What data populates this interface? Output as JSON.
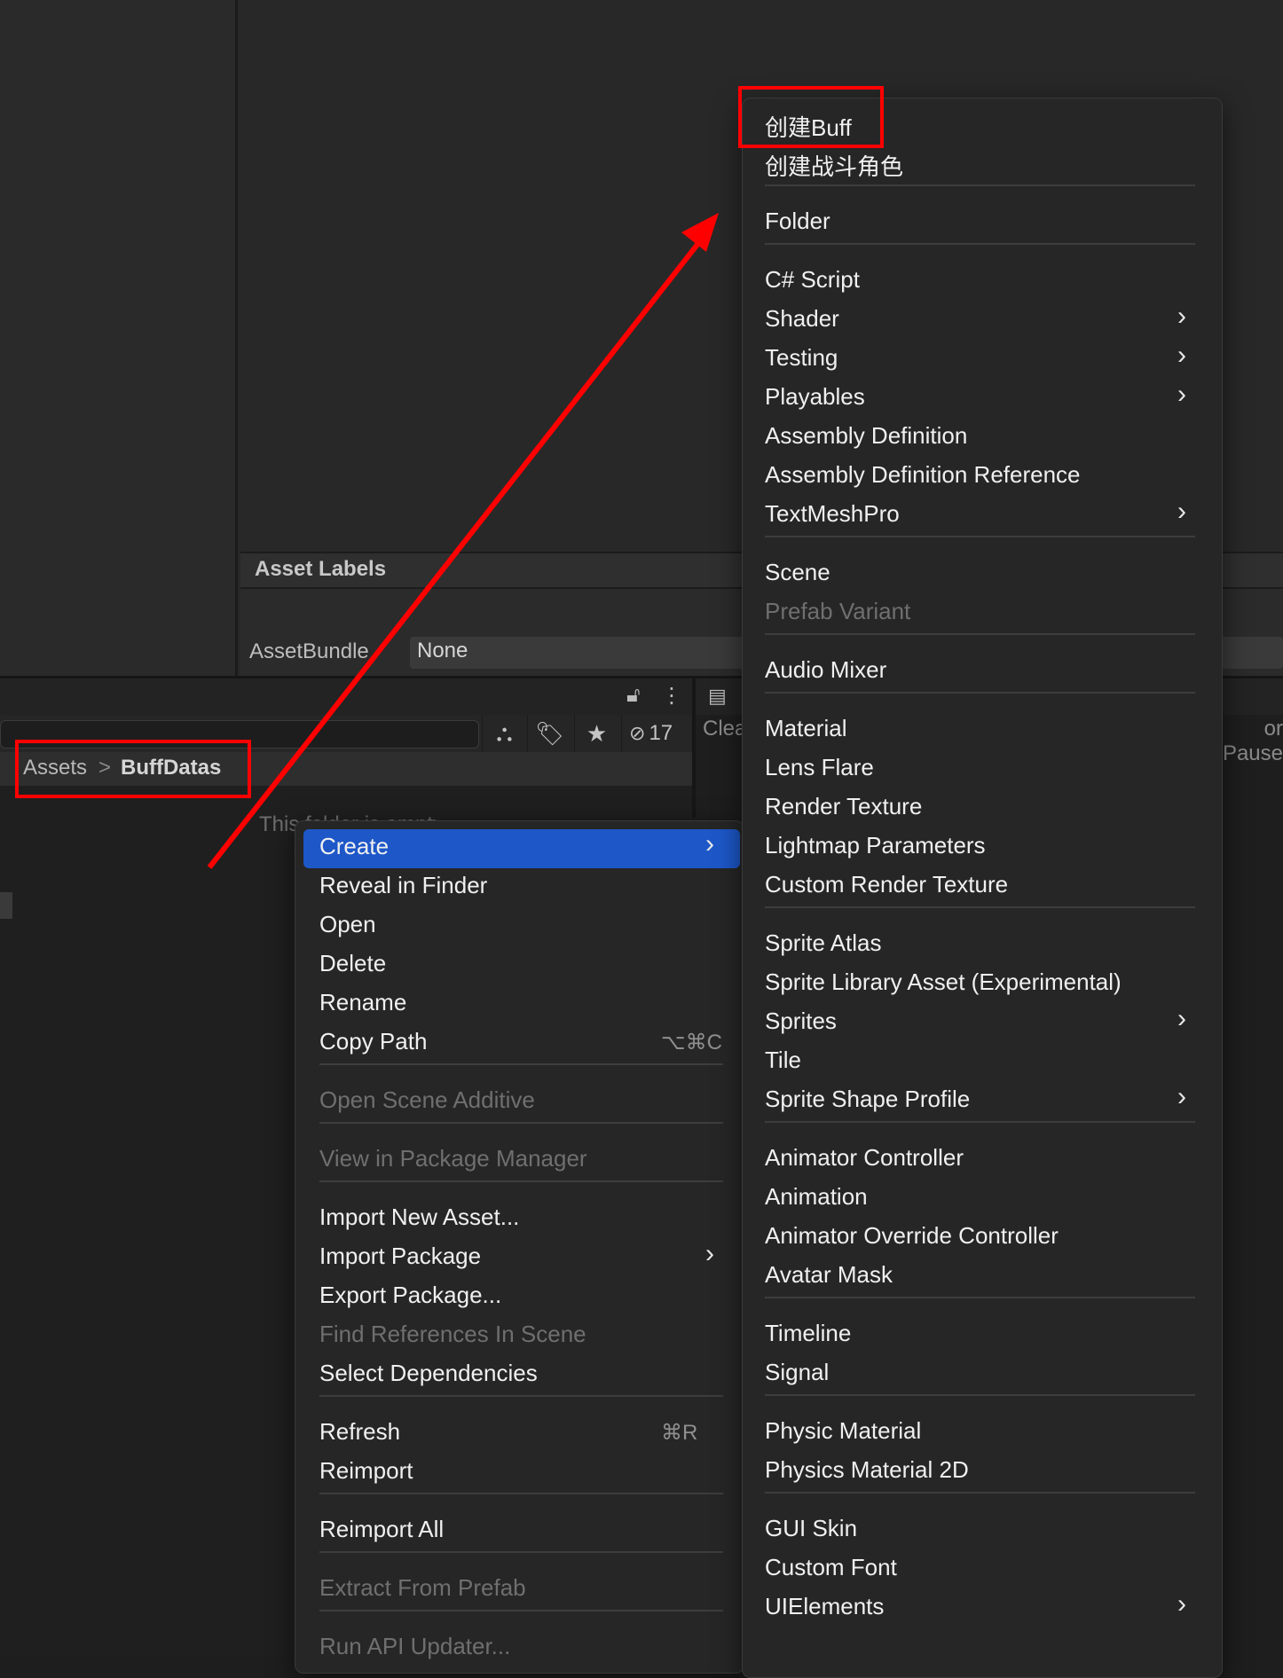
{
  "inspector": {
    "asset_labels_title": "Asset Labels",
    "assetbundle_label": "AssetBundle",
    "assetbundle_value": "None"
  },
  "project": {
    "hidden_count": "17",
    "breadcrumb": {
      "root": "Assets",
      "separator": ">",
      "folder": "BuffDatas"
    },
    "empty_hint": "This folder is empty"
  },
  "console": {
    "clear_label": "Clear",
    "pause_label": "or Pause"
  },
  "context_menu": {
    "items": [
      {
        "label": "Create",
        "submenu": true,
        "highlighted": true
      },
      {
        "label": "Reveal in Finder"
      },
      {
        "label": "Open"
      },
      {
        "label": "Delete"
      },
      {
        "label": "Rename"
      },
      {
        "label": "Copy Path",
        "shortcut": "⌥⌘C"
      },
      {
        "label": "Open Scene Additive",
        "disabled": true
      },
      {
        "label": "View in Package Manager",
        "disabled": true
      },
      {
        "label": "Import New Asset..."
      },
      {
        "label": "Import Package",
        "submenu": true
      },
      {
        "label": "Export Package..."
      },
      {
        "label": "Find References In Scene",
        "disabled": true
      },
      {
        "label": "Select Dependencies"
      },
      {
        "label": "Refresh",
        "shortcut": "⌘R"
      },
      {
        "label": "Reimport"
      },
      {
        "label": "Reimport All"
      },
      {
        "label": "Extract From Prefab",
        "disabled": true
      },
      {
        "label": "Run API Updater...",
        "disabled": true
      }
    ]
  },
  "create_menu": {
    "items": [
      {
        "label": "创建Buff"
      },
      {
        "label": "创建战斗角色"
      },
      {
        "label": "Folder"
      },
      {
        "label": "C# Script"
      },
      {
        "label": "Shader",
        "submenu": true
      },
      {
        "label": "Testing",
        "submenu": true
      },
      {
        "label": "Playables",
        "submenu": true
      },
      {
        "label": "Assembly Definition"
      },
      {
        "label": "Assembly Definition Reference"
      },
      {
        "label": "TextMeshPro",
        "submenu": true
      },
      {
        "label": "Scene"
      },
      {
        "label": "Prefab Variant",
        "disabled": true
      },
      {
        "label": "Audio Mixer"
      },
      {
        "label": "Material"
      },
      {
        "label": "Lens Flare"
      },
      {
        "label": "Render Texture"
      },
      {
        "label": "Lightmap Parameters"
      },
      {
        "label": "Custom Render Texture"
      },
      {
        "label": "Sprite Atlas"
      },
      {
        "label": "Sprite Library Asset (Experimental)"
      },
      {
        "label": "Sprites",
        "submenu": true
      },
      {
        "label": "Tile"
      },
      {
        "label": "Sprite Shape Profile",
        "submenu": true
      },
      {
        "label": "Animator Controller"
      },
      {
        "label": "Animation"
      },
      {
        "label": "Animator Override Controller"
      },
      {
        "label": "Avatar Mask"
      },
      {
        "label": "Timeline"
      },
      {
        "label": "Signal"
      },
      {
        "label": "Physic Material"
      },
      {
        "label": "Physics Material 2D"
      },
      {
        "label": "GUI Skin"
      },
      {
        "label": "Custom Font"
      },
      {
        "label": "UIElements",
        "submenu": true
      }
    ]
  },
  "colors": {
    "highlight": "#1d57c8",
    "annotation": "#ff0000",
    "menu_bg": "#262626"
  }
}
